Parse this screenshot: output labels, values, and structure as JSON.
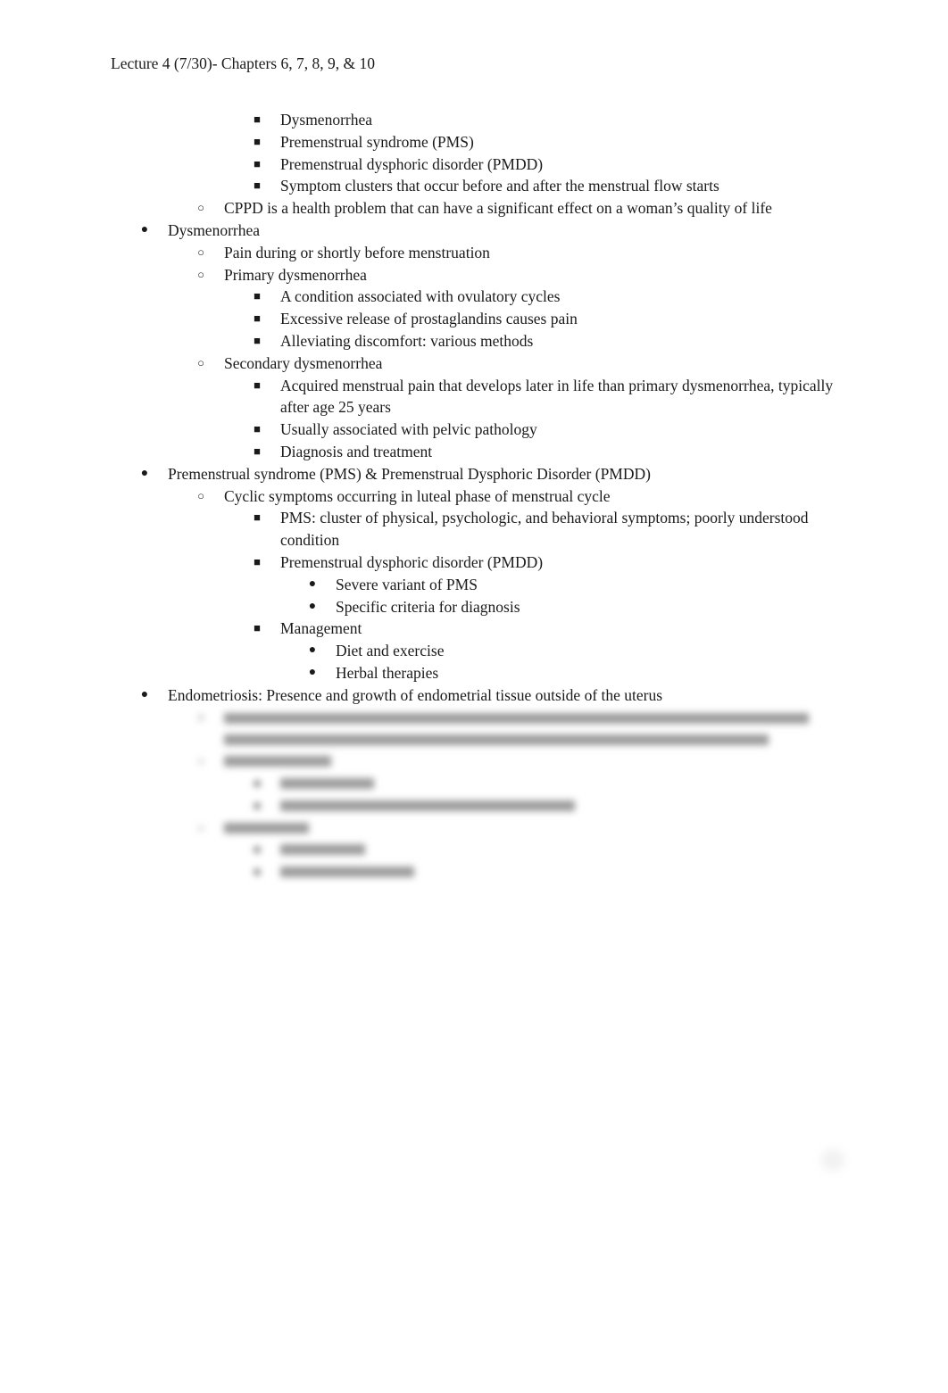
{
  "document": {
    "title": "Lecture 4 (7/30)- Chapters 6, 7, 8, 9, & 10",
    "bullets": {
      "l1": "●",
      "l2": "○",
      "l3": "■",
      "l4": "●"
    },
    "items": [
      {
        "level": 3,
        "text": "Dysmenorrhea"
      },
      {
        "level": 3,
        "text": "Premenstrual syndrome (PMS)"
      },
      {
        "level": 3,
        "text": "Premenstrual dysphoric disorder (PMDD)"
      },
      {
        "level": 3,
        "text": "Symptom clusters that occur before and after the menstrual flow starts"
      },
      {
        "level": 2,
        "text": "CPPD is a health problem that can have a significant effect on a woman’s quality of life"
      },
      {
        "level": 1,
        "text": "Dysmenorrhea"
      },
      {
        "level": 2,
        "text": "Pain during or shortly before menstruation"
      },
      {
        "level": 2,
        "text": "Primary dysmenorrhea"
      },
      {
        "level": 3,
        "text": "A condition associated with ovulatory cycles"
      },
      {
        "level": 3,
        "text": "Excessive release of prostaglandins causes pain"
      },
      {
        "level": 3,
        "text": "Alleviating discomfort: various methods"
      },
      {
        "level": 2,
        "text": "Secondary dysmenorrhea"
      },
      {
        "level": 3,
        "text": "Acquired menstrual pain that develops later in life than primary dysmenorrhea, typically after age 25 years"
      },
      {
        "level": 3,
        "text": "Usually associated with pelvic pathology"
      },
      {
        "level": 3,
        "text": "Diagnosis and treatment"
      },
      {
        "level": 1,
        "text": "Premenstrual syndrome (PMS) & Premenstrual Dysphoric Disorder (PMDD)"
      },
      {
        "level": 2,
        "text": "Cyclic symptoms occurring in luteal phase of menstrual cycle"
      },
      {
        "level": 3,
        "text": "PMS: cluster of physical, psychologic, and behavioral symptoms; poorly understood condition"
      },
      {
        "level": 3,
        "text": "Premenstrual dysphoric disorder (PMDD)"
      },
      {
        "level": 4,
        "text": "Severe variant of PMS"
      },
      {
        "level": 4,
        "text": "Specific criteria for diagnosis"
      },
      {
        "level": 3,
        "text": "Management"
      },
      {
        "level": 4,
        "text": "Diet and exercise"
      },
      {
        "level": 4,
        "text": "Herbal therapies"
      },
      {
        "level": 1,
        "text": "Endometriosis: Presence and growth of endometrial tissue outside of the uterus"
      }
    ],
    "blurred_section_note": "Remaining content is blurred/obscured"
  }
}
